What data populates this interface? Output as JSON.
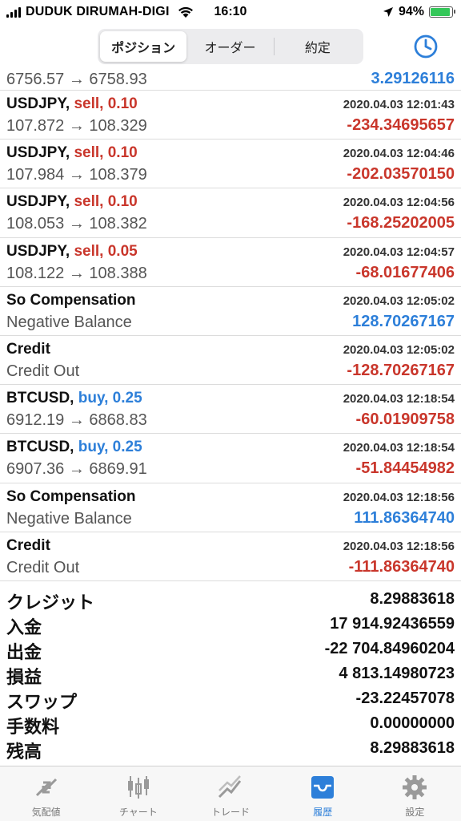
{
  "status_bar": {
    "carrier": "DUDUK DIRUMAH-DIGI",
    "time": "16:10",
    "battery": "94%"
  },
  "segments": {
    "positions": "ポジション",
    "orders": "オーダー",
    "deals": "約定"
  },
  "first_row": {
    "prices": "6756.57 → 6758.93",
    "value": "3.29126116"
  },
  "rows": [
    {
      "symbol": "USDJPY,",
      "side": "sell, 0.10",
      "side_type": "sell",
      "date": "2020.04.03 12:01:43",
      "detail": "107.872 → 108.329",
      "value": "-234.34695657",
      "value_type": "neg"
    },
    {
      "symbol": "USDJPY,",
      "side": "sell, 0.10",
      "side_type": "sell",
      "date": "2020.04.03 12:04:46",
      "detail": "107.984 → 108.379",
      "value": "-202.03570150",
      "value_type": "neg"
    },
    {
      "symbol": "USDJPY,",
      "side": "sell, 0.10",
      "side_type": "sell",
      "date": "2020.04.03 12:04:56",
      "detail": "108.053 → 108.382",
      "value": "-168.25202005",
      "value_type": "neg"
    },
    {
      "symbol": "USDJPY,",
      "side": "sell, 0.05",
      "side_type": "sell",
      "date": "2020.04.03 12:04:57",
      "detail": "108.122 → 108.388",
      "value": "-68.01677406",
      "value_type": "neg"
    },
    {
      "symbol": "So Compensation",
      "side": "",
      "side_type": "",
      "date": "2020.04.03 12:05:02",
      "detail": "Negative Balance",
      "value": "128.70267167",
      "value_type": "pos"
    },
    {
      "symbol": "Credit",
      "side": "",
      "side_type": "",
      "date": "2020.04.03 12:05:02",
      "detail": "Credit Out",
      "value": "-128.70267167",
      "value_type": "neg"
    },
    {
      "symbol": "BTCUSD,",
      "side": "buy, 0.25",
      "side_type": "buy",
      "date": "2020.04.03 12:18:54",
      "detail": "6912.19 → 6868.83",
      "value": "-60.01909758",
      "value_type": "neg"
    },
    {
      "symbol": "BTCUSD,",
      "side": "buy, 0.25",
      "side_type": "buy",
      "date": "2020.04.03 12:18:54",
      "detail": "6907.36 → 6869.91",
      "value": "-51.84454982",
      "value_type": "neg"
    },
    {
      "symbol": "So Compensation",
      "side": "",
      "side_type": "",
      "date": "2020.04.03 12:18:56",
      "detail": "Negative Balance",
      "value": "111.86364740",
      "value_type": "pos"
    },
    {
      "symbol": "Credit",
      "side": "",
      "side_type": "",
      "date": "2020.04.03 12:18:56",
      "detail": "Credit Out",
      "value": "-111.86364740",
      "value_type": "neg"
    }
  ],
  "summary": [
    {
      "label": "クレジット",
      "value": "8.29883618"
    },
    {
      "label": "入金",
      "value": "17 914.92436559"
    },
    {
      "label": "出金",
      "value": "-22 704.84960204"
    },
    {
      "label": "損益",
      "value": "4 813.14980723"
    },
    {
      "label": "スワップ",
      "value": "-23.22457078"
    },
    {
      "label": "手数料",
      "value": "0.00000000"
    },
    {
      "label": "残高",
      "value": "8.29883618"
    }
  ],
  "tabs": [
    {
      "label": "気配値",
      "icon": "quotes-icon"
    },
    {
      "label": "チャート",
      "icon": "chart-icon"
    },
    {
      "label": "トレード",
      "icon": "trade-icon"
    },
    {
      "label": "履歴",
      "icon": "history-icon"
    },
    {
      "label": "設定",
      "icon": "settings-icon"
    }
  ],
  "colors": {
    "sell": "#c9362b",
    "buy": "#2d7fd9",
    "negative": "#c9362b",
    "positive": "#2d7fd9",
    "active_tab": "#2d7fd9"
  }
}
